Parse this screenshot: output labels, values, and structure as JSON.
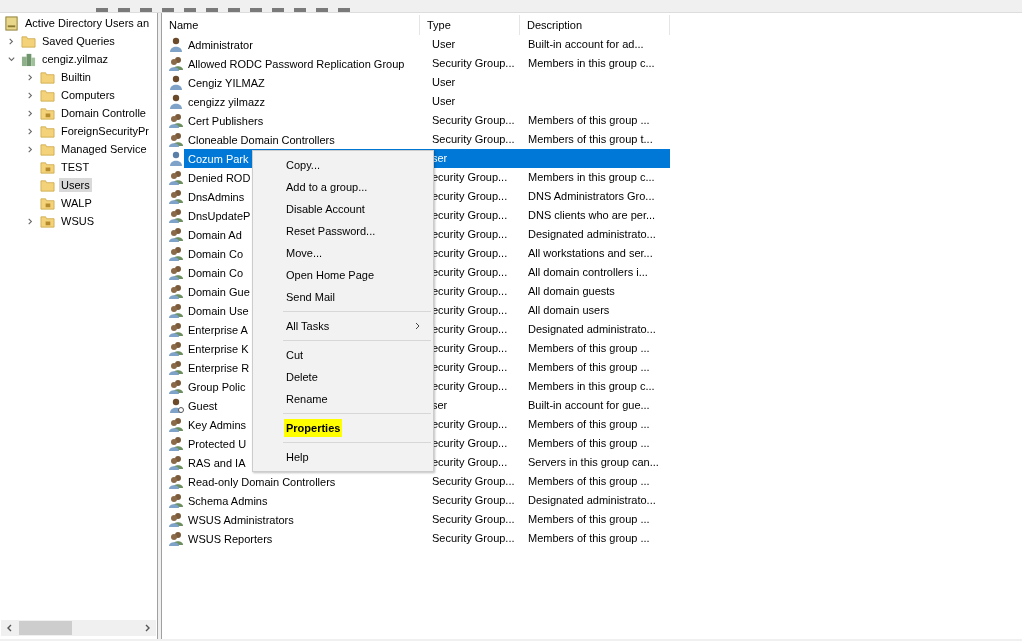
{
  "tree": {
    "label": "Active Directory Users an",
    "children": [
      {
        "label": "Saved Queries",
        "kind": "folder",
        "expandable": true,
        "expanded": false,
        "selected": false
      },
      {
        "label": "cengiz.yilmaz",
        "kind": "domain",
        "expandable": true,
        "expanded": true,
        "selected": false,
        "children": [
          {
            "label": "Builtin",
            "kind": "folder",
            "expandable": true,
            "expanded": false,
            "selected": false
          },
          {
            "label": "Computers",
            "kind": "folder",
            "expandable": true,
            "expanded": false,
            "selected": false
          },
          {
            "label": "Domain Controlle",
            "kind": "ou",
            "expandable": true,
            "expanded": false,
            "selected": false
          },
          {
            "label": "ForeignSecurityPr",
            "kind": "folder",
            "expandable": true,
            "expanded": false,
            "selected": false
          },
          {
            "label": "Managed Service",
            "kind": "folder",
            "expandable": true,
            "expanded": false,
            "selected": false
          },
          {
            "label": "TEST",
            "kind": "ou",
            "expandable": false,
            "selected": false
          },
          {
            "label": "Users",
            "kind": "folder",
            "expandable": false,
            "selected": true
          },
          {
            "label": "WALP",
            "kind": "ou",
            "expandable": false,
            "selected": false
          },
          {
            "label": "WSUS",
            "kind": "ou",
            "expandable": true,
            "expanded": false,
            "selected": false
          }
        ]
      }
    ]
  },
  "table": {
    "columns": [
      "Name",
      "Type",
      "Description"
    ],
    "rows": [
      {
        "kind": "user",
        "selected": false,
        "name": "Administrator",
        "type": "User",
        "description": "Built-in account for ad..."
      },
      {
        "kind": "group",
        "selected": false,
        "name": "Allowed RODC Password Replication Group",
        "type": "Security Group...",
        "description": "Members in this group c..."
      },
      {
        "kind": "user",
        "selected": false,
        "name": "Cengiz YILMAZ",
        "type": "User"
      },
      {
        "kind": "user",
        "selected": false,
        "name": "cengizz yilmazz",
        "type": "User"
      },
      {
        "kind": "group",
        "selected": false,
        "name": "Cert Publishers",
        "type": "Security Group...",
        "description": "Members of this group ..."
      },
      {
        "kind": "group",
        "selected": false,
        "name": "Cloneable Domain Controllers",
        "type": "Security Group...",
        "description": "Members of this group t..."
      },
      {
        "kind": "user",
        "selected": true,
        "name": "Cozum Park",
        "type": "ser"
      },
      {
        "kind": "group",
        "selected": false,
        "name": "Denied ROD",
        "type": "ecurity Group...",
        "description": "Members in this group c..."
      },
      {
        "kind": "group",
        "selected": false,
        "name": "DnsAdmins",
        "type": "ecurity Group...",
        "description": "DNS Administrators Gro..."
      },
      {
        "kind": "group",
        "selected": false,
        "name": "DnsUpdateP",
        "type": "ecurity Group...",
        "description": "DNS clients who are per..."
      },
      {
        "kind": "group",
        "selected": false,
        "name": "Domain Ad",
        "type": "ecurity Group...",
        "description": "Designated administrato..."
      },
      {
        "kind": "group",
        "selected": false,
        "name": "Domain Co",
        "type": "ecurity Group...",
        "description": "All workstations and ser..."
      },
      {
        "kind": "group",
        "selected": false,
        "name": "Domain Co",
        "type": "ecurity Group...",
        "description": "All domain controllers i..."
      },
      {
        "kind": "group",
        "selected": false,
        "name": "Domain Gue",
        "type": "ecurity Group...",
        "description": "All domain guests"
      },
      {
        "kind": "group",
        "selected": false,
        "name": "Domain Use",
        "type": "ecurity Group...",
        "description": "All domain users"
      },
      {
        "kind": "group",
        "selected": false,
        "name": "Enterprise A",
        "type": "ecurity Group...",
        "description": "Designated administrato..."
      },
      {
        "kind": "group",
        "selected": false,
        "name": "Enterprise K",
        "type": "ecurity Group...",
        "description": "Members of this group ..."
      },
      {
        "kind": "group",
        "selected": false,
        "name": "Enterprise R",
        "type": "ecurity Group...",
        "description": "Members of this group ..."
      },
      {
        "kind": "group",
        "selected": false,
        "name": "Group Polic",
        "type": "ecurity Group...",
        "description": "Members in this group c..."
      },
      {
        "kind": "guest",
        "selected": false,
        "name": "Guest",
        "type": "ser",
        "description": "Built-in account for gue..."
      },
      {
        "kind": "group",
        "selected": false,
        "name": "Key Admins",
        "type": "ecurity Group...",
        "description": "Members of this group ..."
      },
      {
        "kind": "group",
        "selected": false,
        "name": "Protected U",
        "type": "ecurity Group...",
        "description": "Members of this group ..."
      },
      {
        "kind": "group",
        "selected": false,
        "name": "RAS and IA",
        "type": "ecurity Group...",
        "description": "Servers in this group can..."
      },
      {
        "kind": "group",
        "selected": false,
        "name": "Read-only Domain Controllers",
        "type": "Security Group...",
        "description": "Members of this group ..."
      },
      {
        "kind": "group",
        "selected": false,
        "name": "Schema Admins",
        "type": "Security Group...",
        "description": "Designated administrato..."
      },
      {
        "kind": "group",
        "selected": false,
        "name": "WSUS Administrators",
        "type": "Security Group...",
        "description": "Members of this group ..."
      },
      {
        "kind": "group",
        "selected": false,
        "name": "WSUS Reporters",
        "type": "Security Group...",
        "description": "Members of this group ..."
      }
    ]
  },
  "context_menu": [
    {
      "kind": "item",
      "label": "Copy..."
    },
    {
      "kind": "item",
      "label": "Add to a group..."
    },
    {
      "kind": "item",
      "label": "Disable Account"
    },
    {
      "kind": "item",
      "label": "Reset Password..."
    },
    {
      "kind": "item",
      "label": "Move..."
    },
    {
      "kind": "item",
      "label": "Open Home Page"
    },
    {
      "kind": "item",
      "label": "Send Mail"
    },
    {
      "kind": "separator"
    },
    {
      "kind": "submenu",
      "label": "All Tasks"
    },
    {
      "kind": "separator"
    },
    {
      "kind": "item",
      "label": "Cut"
    },
    {
      "kind": "item",
      "label": "Delete"
    },
    {
      "kind": "item",
      "label": "Rename"
    },
    {
      "kind": "separator"
    },
    {
      "kind": "item",
      "label": "Properties",
      "highlighted": true
    },
    {
      "kind": "separator"
    },
    {
      "kind": "item",
      "label": "Help"
    }
  ]
}
